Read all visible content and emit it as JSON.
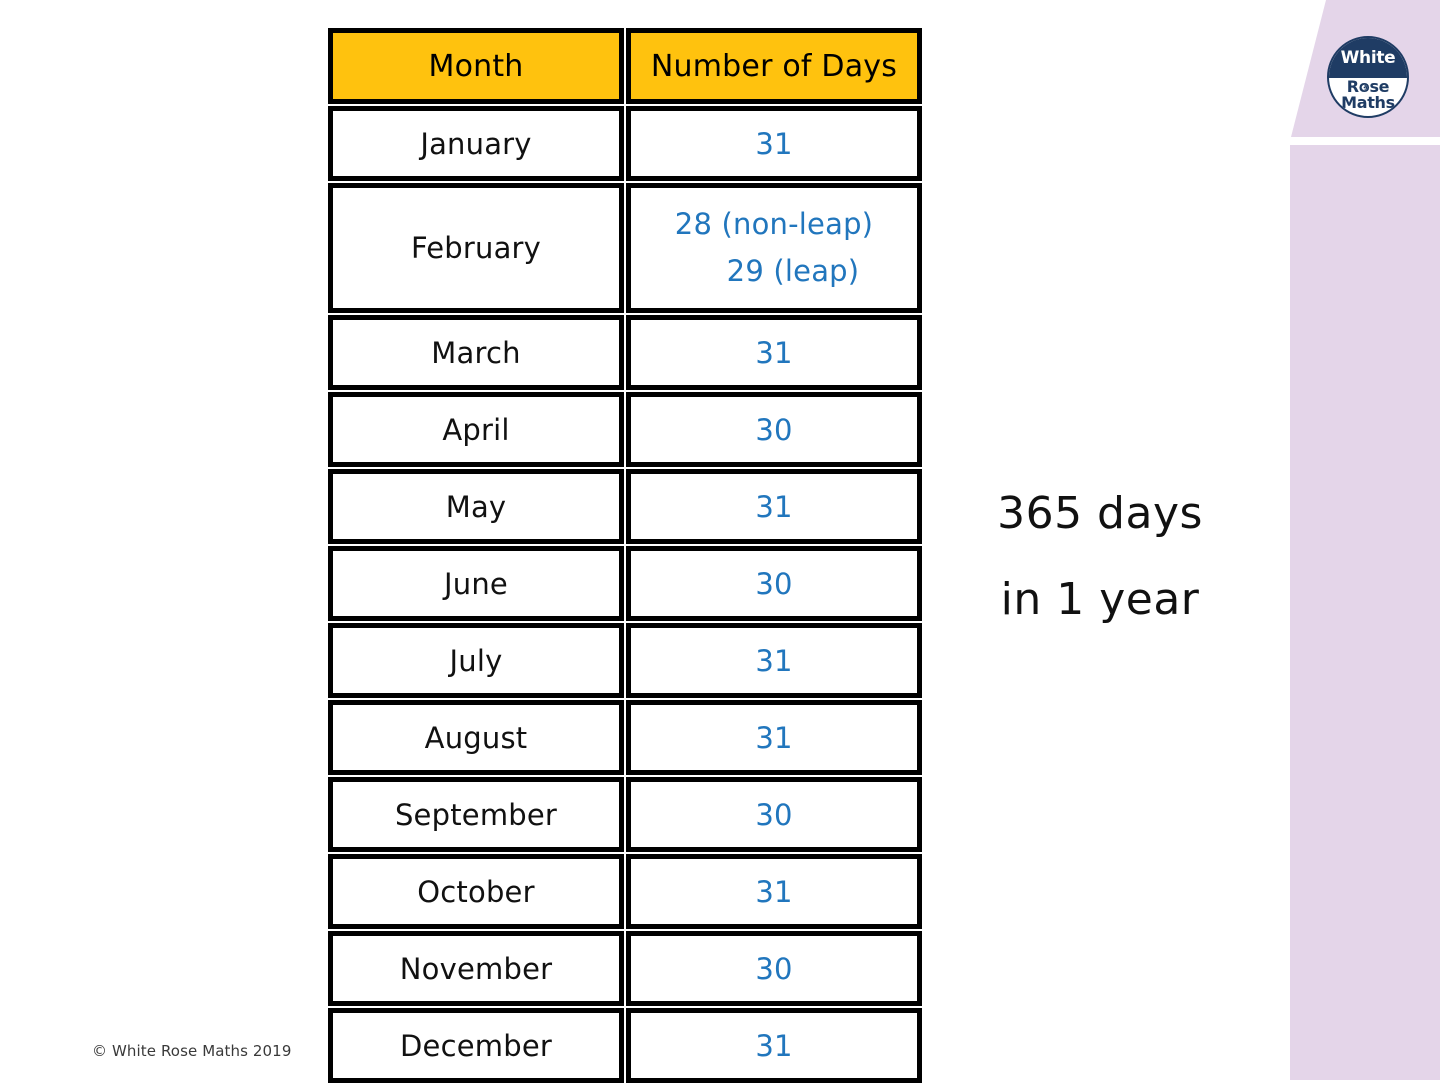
{
  "slide": {
    "background_color": "#ffffff",
    "accent_color": "#ffc20e",
    "number_color": "#2176bd",
    "decor_color": "#e4d5e9",
    "logo_navy": "#1f3c64"
  },
  "logo": {
    "line1": "White",
    "line2": "Rose",
    "line3": "Maths"
  },
  "table": {
    "headers": {
      "month": "Month",
      "days": "Number of Days"
    },
    "rows": [
      {
        "month": "January",
        "days": "31"
      },
      {
        "month": "February",
        "days_line1": "28 (non-leap)",
        "days_line2": "29 (leap)",
        "tall": true
      },
      {
        "month": "March",
        "days": "31"
      },
      {
        "month": "April",
        "days": "30"
      },
      {
        "month": "May",
        "days": "31"
      },
      {
        "month": "June",
        "days": "30"
      },
      {
        "month": "July",
        "days": "31"
      },
      {
        "month": "August",
        "days": "31"
      },
      {
        "month": "September",
        "days": "30"
      },
      {
        "month": "October",
        "days": "31"
      },
      {
        "month": "November",
        "days": "30"
      },
      {
        "month": "December",
        "days": "31"
      }
    ]
  },
  "summary": {
    "line1": "365 days",
    "line2": "in 1 year"
  },
  "footer": {
    "copyright": "© White Rose Maths 2019"
  }
}
